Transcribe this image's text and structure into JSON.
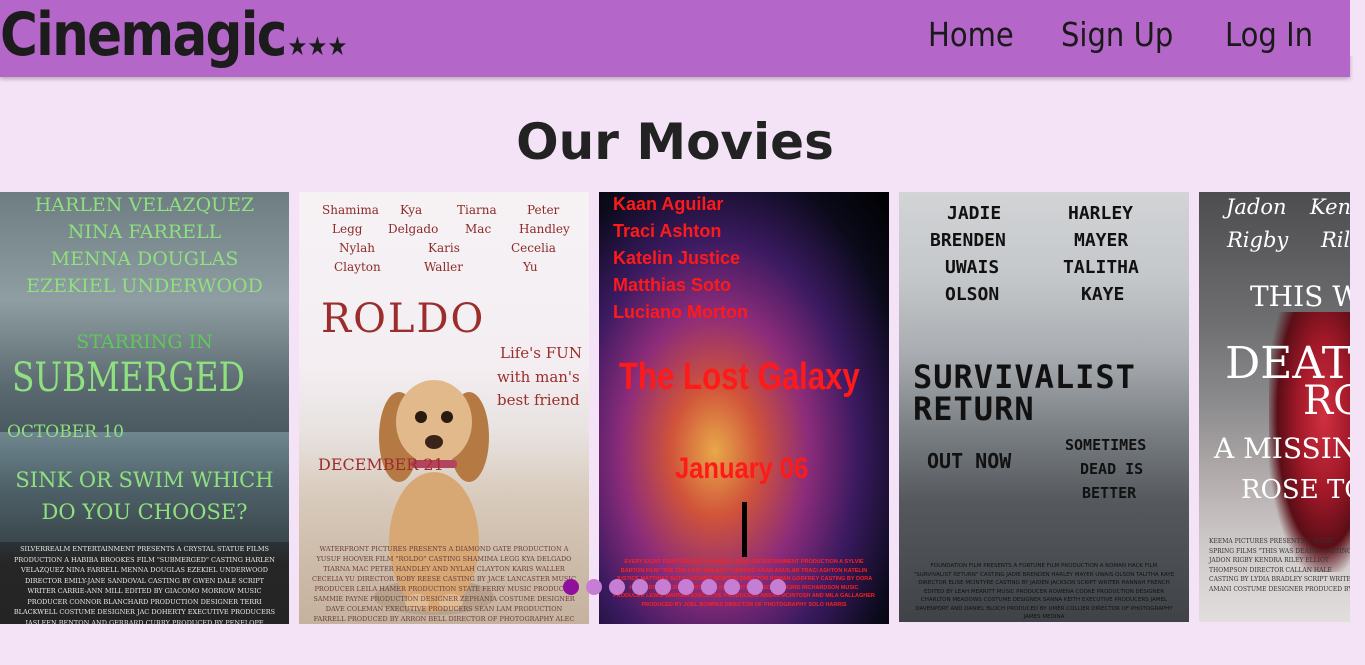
{
  "header": {
    "logo_text": "Cinemagic",
    "logo_stars": "★★★",
    "nav": [
      "Home",
      "Sign Up",
      "Log In"
    ]
  },
  "heading": "Our Movies",
  "posters": [
    {
      "names": [
        "HARLEN VELAZQUEZ",
        "NINA FARRELL",
        "MENNA DOUGLAS",
        "EZEKIEL UNDERWOOD"
      ],
      "starring": "STARRING IN",
      "title": "SUBMERGED",
      "date": "OCTOBER 10",
      "tagline_1": "SINK OR SWIM WHICH",
      "tagline_2": "DO YOU CHOOSE?",
      "credits": "SILVERREALM ENTERTAINMENT PRESENTS A CRYSTAL STATUE FILMS PRODUCTION A HABIBA BROOKES FILM \"SUBMERGED\" CASTING HARLEN VELAZQUEZ NINA FARRELL MENNA DOUGLAS EZEKIEL UNDERWOOD DIRECTOR EMILY-JANE SANDOVAL CASTING BY GWEN DALE SCRIPT WRITER CARRIE-ANN MILL EDITED BY GIACOMO MORROW MUSIC PRODUCER CONNOR BLANCHARD PRODUCTION DESIGNER TERRI BLACKWELL COSTUME DESIGNER JAC DOHERTY EXECUTIVE PRODUCERS JASLEEN BENTON AND GERRARD CURRY PRODUCED BY PENELOPE DAVENPORT DIRECTOR OF PHOTOGRAPHY GLORIA ROWLEY DAVID WEBER"
    },
    {
      "cast": [
        "Shamima",
        "Kya",
        "Tiarna",
        "Peter",
        "Legg",
        "Delgado",
        "Mac",
        "Handley",
        "Nylah",
        "Karis",
        "Cecelia",
        "Clayton",
        "Waller",
        "Yu"
      ],
      "title": "ROLDO",
      "tagline": [
        "Life's FUN",
        "with man's",
        "best friend"
      ],
      "date": "DECEMBER 21",
      "credits": "WATERFRONT PICTURES PRESENTS A DIAMOND GATE PRODUCTION A YUSUF HOOVER FILM \"ROLDO\" CASTING SHAMIMA LEGG KYA DELGADO TIARNA MAC PETER HANDLEY AND NYLAH CLAYTON KARIS WALLER CECELIA YU DIRECTOR ROBY REESE CASTING BY JACE LANCASTER MUSIC PRODUCER LEILA HAMER PRODUCTION STATE FERRY MUSIC PRODUCER SAMMIE PAYNE PRODUCTION DESIGNER ZEPHANIA COSTUME DESIGNER DAVE COLEMAN EXECUTIVE PRODUCERS SEAN LAM PRODUCTION FARRELL PRODUCED BY ARRON BELL DIRECTOR OF PHOTOGRAPHY ALEC BOLTON"
    },
    {
      "cast": [
        "Kaan Aguilar",
        "Traci Ashton",
        "Katelin Justice",
        "Matthias Soto",
        "Luciano Morton"
      ],
      "title": "The Lost Galaxy",
      "date": "January 06",
      "credits": "EVERY EIGHT FILM PRESENTS A ANGEL WORK ENTERTAINMENT PRODUCTION A SYLVIE BARTON FILM \"THE THE LOST GALAXY\" CASTING KAAN AGUILAR TRACI ASHTON KATELIN JUSTICE MATTHIAS SOTO LUCIANO MORTON DIRECTOR ROMAN GODFREY CASTING BY DORA HENDERSON SCRIPT WRITER BLAKE WHITE EDITED BY SIGRID RICHARDSON MUSIC PRODUCER LEWIS WARNER EXECUTIVE PRODUCERS ABBAS MCINTOSH AND MILA GALLAGHER PRODUCED BY JOEL BOMPAS DIRECTOR OF PHOTOGRAPHY SOLO HARRIS"
    },
    {
      "cast_left": [
        "JADIE",
        "BRENDEN",
        "UWAIS",
        "OLSON"
      ],
      "cast_right": [
        "HARLEY",
        "MAYER",
        "TALITHA",
        "KAYE"
      ],
      "title_1": "SURVIVALIST",
      "title_2": "RETURN",
      "status": "OUT NOW",
      "tagline": [
        "SOMETIMES",
        "DEAD IS",
        "BETTER"
      ],
      "credits": "FOUNDATION FILM PRESENTS A FORTUNE FILM PRODUCTION A ROMAN HACK FILM \"SURVIVALIST RETURN\" CASTING JADIE BRENDEN HARLEY MAYER UWAIS OLSON TALITHA KAYE DIRECTOR ELISE MCINTYRE CASTING BY JAIDEN JACKSON SCRIPT WRITER HANNAH FRENCH EDITED BY LEAH MERRITT MUSIC PRODUCER ROWENA COOKE PRODUCTION DESIGNER CHARLTON MEADOWS COSTUME DESIGNER SANNA KEITH EXECUTIVE PRODUCERS JAMEL DAVENPORT AND DANIEL BLOCH PRODUCED BY UMER COLLIER DIRECTOR OF PHOTOGRAPHY JAMES MEDINA"
    },
    {
      "cast": [
        "Jadon",
        "Kend",
        "Rigby",
        "Rile"
      ],
      "title_1": "THIS W",
      "title_2": "DEAT",
      "title_3": "RO",
      "tagline_1": "A MISSING",
      "tagline_2": "ROSE TOO",
      "credits": "KEEMA PICTURES PRESENTS A MAGIC SPRING FILMS \"THIS WAS DEATH\" CASTING JADON RIGBY KENDRA RILEY ELLIOT THOMPSON DIRECTOR CALLAN HALE CASTING BY LYDIA BRADLEY SCRIPT WRITER AMANI COSTUME DESIGNER PRODUCED BY"
    }
  ],
  "carousel": {
    "dot_count": 10,
    "active_index": 0
  }
}
